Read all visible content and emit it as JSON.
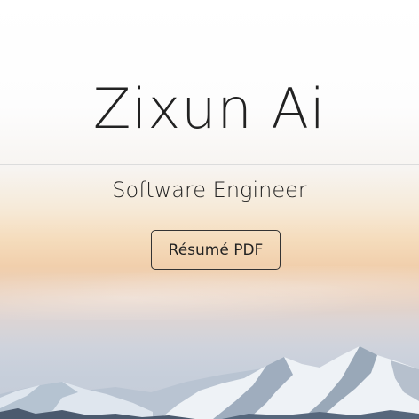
{
  "hero": {
    "name": "Zixun Ai",
    "subtitle": "Software Engineer",
    "resume_button": "Résumé PDF"
  },
  "colors": {
    "text": "#222222",
    "divider": "#dcdcdc",
    "sky_top": "#ffffff",
    "sky_glow": "#f5dcbc",
    "mountain_snow": "#e8edf3",
    "mountain_shadow": "#5a6b80"
  }
}
